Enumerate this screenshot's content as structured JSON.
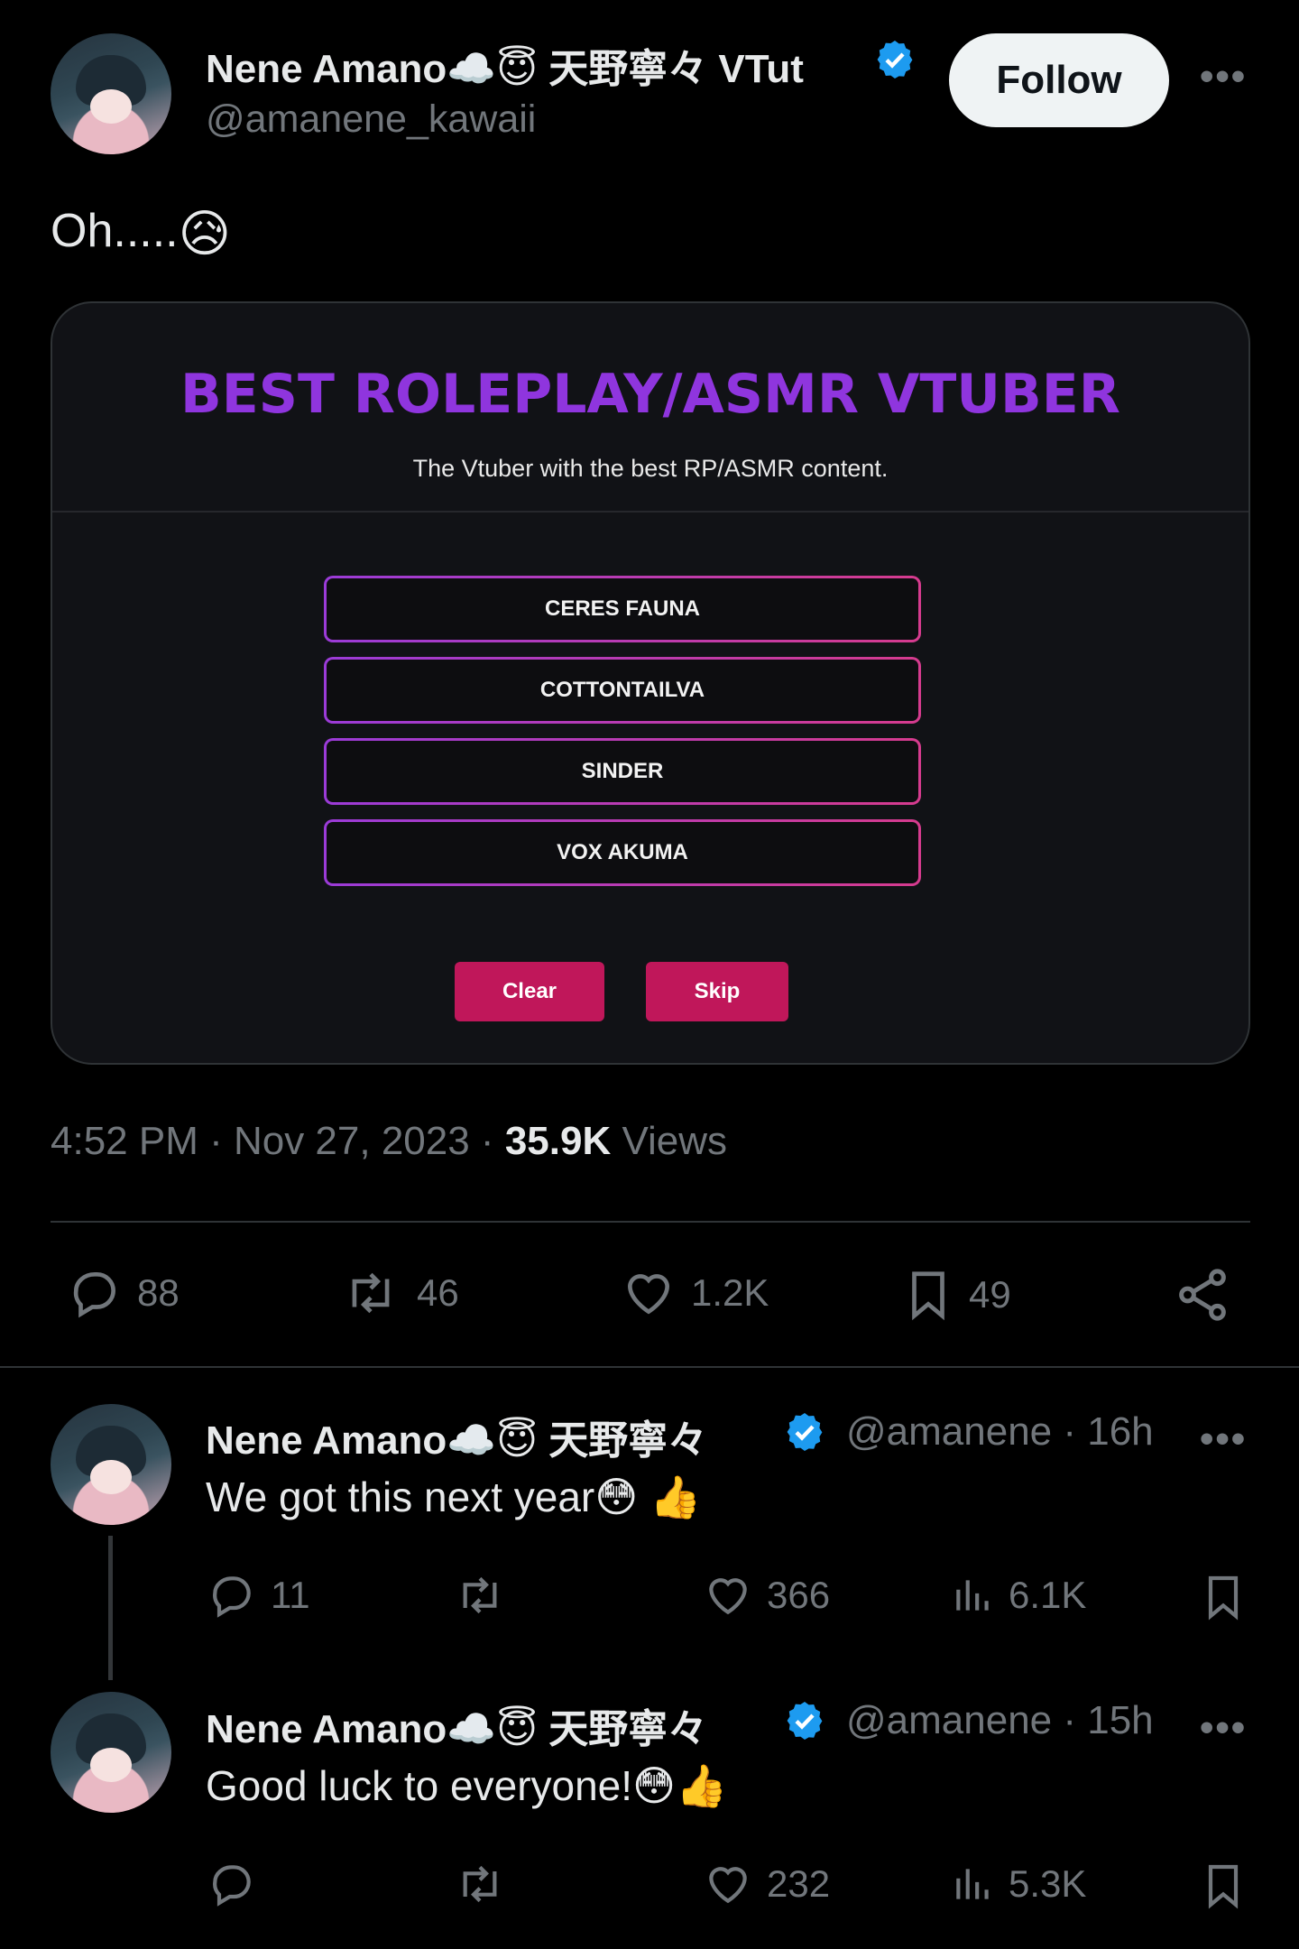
{
  "main_tweet": {
    "author_name": "Nene Amano☁️😇 天野寧々 VTut",
    "handle": "@amanene_kawaii",
    "follow_label": "Follow",
    "more_label": "•••",
    "text": "Oh.....",
    "text_emoji": "😥",
    "timestamp": "4:52 PM · Nov 27, 2023 · ",
    "views_count": "35.9K",
    "views_label": " Views",
    "stats": {
      "replies": "88",
      "reposts": "46",
      "likes": "1.2K",
      "bookmarks": "49"
    }
  },
  "poll_card": {
    "title": "BEST ROLEPLAY/ASMR VTUBER",
    "subtitle": "The Vtuber with the best RP/ASMR content.",
    "options": [
      "CERES FAUNA",
      "COTTONTAILVA",
      "SINDER",
      "VOX AKUMA"
    ],
    "clear_label": "Clear",
    "skip_label": "Skip"
  },
  "replies": [
    {
      "author_name": "Nene Amano☁️😇 天野寧々 ",
      "handle_time": "@amanene · 16h",
      "text": "We got this next year😳 👍",
      "more_label": "•••",
      "stats": {
        "replies": "11",
        "reposts": "",
        "likes": "366",
        "views": "6.1K"
      }
    },
    {
      "author_name": "Nene Amano☁️😇 天野寧々 ",
      "handle_time": "@amanene · 15h",
      "text": "Good luck to everyone!😳👍",
      "more_label": "•••",
      "stats": {
        "replies": "",
        "reposts": "",
        "likes": "232",
        "views": "5.3K"
      }
    }
  ],
  "colors": {
    "accent": "#1d9bf0",
    "poll_title": "#8f35de",
    "pink_button": "#c0175a"
  },
  "icons": [
    "verified-badge-icon",
    "reply-icon",
    "repost-icon",
    "like-icon",
    "bookmark-icon",
    "share-icon",
    "views-icon"
  ]
}
